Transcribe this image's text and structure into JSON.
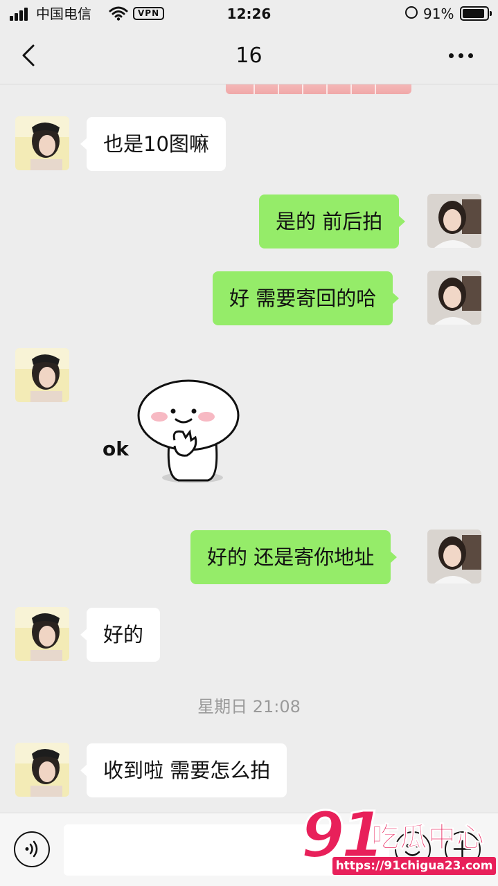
{
  "status_bar": {
    "carrier": "中国电信",
    "vpn": "VPN",
    "time": "12:26",
    "battery": "91%",
    "battery_level": 0.91
  },
  "header": {
    "title": "16",
    "back_icon": "chevron-left-icon",
    "more_icon": "more-dots-icon"
  },
  "messages": [
    {
      "side": "in",
      "text": "也是10图嘛"
    },
    {
      "side": "out",
      "text": "是的 前后拍"
    },
    {
      "side": "out",
      "text": "好 需要寄回的哈"
    },
    {
      "side": "in",
      "type": "sticker",
      "text": "ok"
    },
    {
      "side": "out",
      "text": "好的 还是寄你地址"
    },
    {
      "side": "in",
      "text": "好的"
    },
    {
      "type": "timestamp",
      "text": "星期日 21:08"
    },
    {
      "side": "in",
      "text": "收到啦 需要怎么拍"
    }
  ],
  "input_bar": {
    "voice_icon": "voice-icon",
    "emoji_icon": "emoji-icon",
    "plus_icon": "plus-icon"
  },
  "watermark": {
    "number": "91",
    "text": "吃瓜中心",
    "url": "https://91chigua23.com"
  },
  "colors": {
    "background": "#ededed",
    "incoming_bubble": "#ffffff",
    "outgoing_bubble": "#95ec69",
    "watermark": "#e8205a"
  }
}
